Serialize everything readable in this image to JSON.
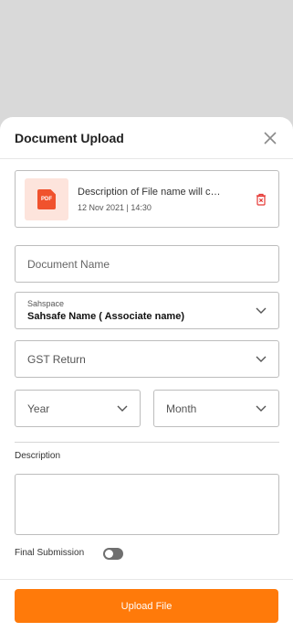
{
  "sheet": {
    "title": "Document Upload"
  },
  "file": {
    "type_label": "PDF",
    "name": "Description of File name will co...",
    "date": "12 Nov 2021 | 14:30"
  },
  "form": {
    "document_name_placeholder": "Document Name",
    "sahspace": {
      "label": "Sahspace",
      "value": "Sahsafe Name ( Associate name)"
    },
    "doc_type_value": "GST Return",
    "year_placeholder": "Year",
    "month_placeholder": "Month",
    "description_label": "Description",
    "final_submission_label": "Final Submission",
    "final_submission_on": false
  },
  "footer": {
    "upload_label": "Upload File"
  },
  "colors": {
    "accent": "#ff7a0a",
    "pdf_red": "#f0522d",
    "delete_red": "#e53935"
  }
}
